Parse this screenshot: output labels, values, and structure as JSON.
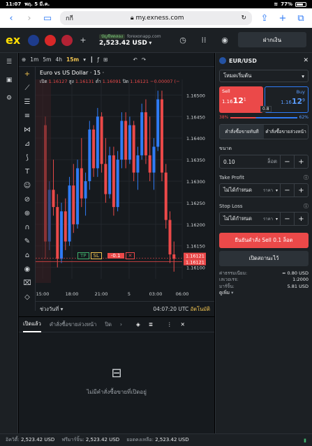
{
  "status": {
    "time": "11:07",
    "date": "พฤ. 5 มี.ค.",
    "battery": "77%"
  },
  "browser": {
    "tab_text": "กกี",
    "url": "my.exness.com"
  },
  "header": {
    "logo": "ex",
    "flags": [
      "GBP",
      "CHF",
      "USD"
    ],
    "account_tag": "บัญชีทดลอง",
    "account_host": "forexonapp.com",
    "balance": "2,523.42 USD",
    "deposit_label": "ฝากเงิน"
  },
  "chart": {
    "title": "Euro vs US Dollar · 15 ·",
    "timeframes": [
      "1m",
      "5m",
      "4h",
      "15m"
    ],
    "selected_timeframe": "15m",
    "ohlc": {
      "open_label": "เปิด",
      "open": "1.16127",
      "high_label": "สูง",
      "high": "1.16131",
      "low_label": "ต่ำ",
      "low": "1.16091",
      "close_label": "ปิด",
      "close": "1.16121",
      "change": "−0.00007 (−"
    },
    "price_ticks": [
      "1.16500",
      "1.16450",
      "1.16400",
      "1.16350",
      "1.16300",
      "1.16250",
      "1.16200",
      "1.16150",
      "1.16100"
    ],
    "time_ticks": [
      "15:00",
      "18:00",
      "21:00",
      "5",
      "03:00",
      "06:00"
    ],
    "current_price": "1.16121",
    "position_line": {
      "tp": "TP",
      "sl": "SL",
      "pnl": "-0.1"
    },
    "footer_range": "ช่วงวันที่",
    "footer_time": "04:07:20 UTC",
    "footer_auto": "อัตโนมัติ",
    "chart_data": {
      "type": "candlestick",
      "title": "Euro vs US Dollar · 15",
      "ylim": [
        1.1608,
        1.1652
      ],
      "candles": [
        [
          1.1643,
          1.1645,
          1.1612,
          1.1616
        ],
        [
          1.1616,
          1.163,
          1.1614,
          1.1628
        ],
        [
          1.1628,
          1.1635,
          1.1622,
          1.1624
        ],
        [
          1.1624,
          1.1627,
          1.161,
          1.1612
        ],
        [
          1.1612,
          1.1625,
          1.1611,
          1.1623
        ],
        [
          1.1623,
          1.1626,
          1.1614,
          1.1616
        ],
        [
          1.1616,
          1.1631,
          1.1615,
          1.1629
        ],
        [
          1.1629,
          1.1634,
          1.1618,
          1.162
        ],
        [
          1.162,
          1.1635,
          1.1619,
          1.1633
        ],
        [
          1.1633,
          1.164,
          1.1624,
          1.1626
        ],
        [
          1.1626,
          1.1632,
          1.1622,
          1.163
        ],
        [
          1.163,
          1.1644,
          1.1628,
          1.1642
        ],
        [
          1.1642,
          1.1643,
          1.1631,
          1.1633
        ],
        [
          1.1633,
          1.1647,
          1.1631,
          1.1645
        ],
        [
          1.1645,
          1.1646,
          1.1632,
          1.1634
        ],
        [
          1.1634,
          1.164,
          1.1625,
          1.1627
        ],
        [
          1.1627,
          1.1638,
          1.1626,
          1.1636
        ],
        [
          1.1636,
          1.1638,
          1.1622,
          1.1624
        ],
        [
          1.1624,
          1.1637,
          1.1623,
          1.1635
        ],
        [
          1.1635,
          1.1646,
          1.1633,
          1.1644
        ],
        [
          1.1644,
          1.1646,
          1.1633,
          1.1635
        ],
        [
          1.1635,
          1.1645,
          1.1634,
          1.1643
        ],
        [
          1.1643,
          1.1644,
          1.163,
          1.1632
        ],
        [
          1.1632,
          1.1638,
          1.1628,
          1.1636
        ],
        [
          1.1636,
          1.1648,
          1.1635,
          1.1646
        ],
        [
          1.1646,
          1.1649,
          1.1634,
          1.1636
        ],
        [
          1.1636,
          1.1645,
          1.163,
          1.1632
        ],
        [
          1.1632,
          1.164,
          1.1628,
          1.1638
        ],
        [
          1.1638,
          1.1651,
          1.1637,
          1.1649
        ],
        [
          1.1649,
          1.1651,
          1.163,
          1.1632
        ],
        [
          1.1632,
          1.1634,
          1.1619,
          1.1621
        ],
        [
          1.1621,
          1.1623,
          1.1611,
          1.1613
        ],
        [
          1.1613,
          1.1616,
          1.1609,
          1.1612
        ]
      ]
    }
  },
  "positions": {
    "tabs": [
      "เปิดแล้ว",
      "คำสั่งซื้อขายล่วงหน้า",
      "ปิด"
    ],
    "empty_text": "ไม่มีคำสั่งซื้อขายที่เปิดอยู่"
  },
  "order": {
    "symbol": "EUR/USD",
    "mode": "โหมดเริ่มต้น",
    "sell_label": "Sell",
    "sell_price_small": "1.16",
    "sell_price_big": "12",
    "sell_price_sup": "1",
    "spread": "0.8",
    "buy_label": "Buy",
    "buy_price_small": "1.16",
    "buy_price_big": "12",
    "buy_price_sup": "9",
    "sell_pct": "38%",
    "buy_pct": "62%",
    "market_tab": "คำสั่งซื้อขายทันที",
    "pending_tab": "คำสั่งซื้อขายล่วงหน้า",
    "volume_label": "ขนาด",
    "volume_value": "0.10",
    "volume_unit": "ล็อต",
    "tp_label": "Take Profit",
    "tp_value": "ไม่ได้กำหนด",
    "tp_unit": "ราคา",
    "sl_label": "Stop Loss",
    "sl_value": "ไม่ได้กำหนด",
    "sl_unit": "ราคา",
    "confirm_label": "ยืนยันคำสั่ง Sell 0.1 ล็อต",
    "advanced_label": "เปิดสถานะไว้",
    "fee_label": "ค่าธรรมเนียม:",
    "fee_value": "≈ 0.80 USD",
    "leverage_label": "เลเวอเรจ:",
    "leverage_value": "1:2000",
    "margin_label": "มาร์จิ้น:",
    "margin_value": "5.81 USD",
    "more_label": "ดูเพิ่ม"
  },
  "bottom": {
    "equity_label": "อิควิตี้:",
    "equity": "2,523.42 USD",
    "free_margin_label": "ฟรีมาร์จิ้น:",
    "free_margin": "2,523.42 USD",
    "balance_label": "ยอดคงเหลือ:",
    "balance": "2,523.42 USD"
  }
}
